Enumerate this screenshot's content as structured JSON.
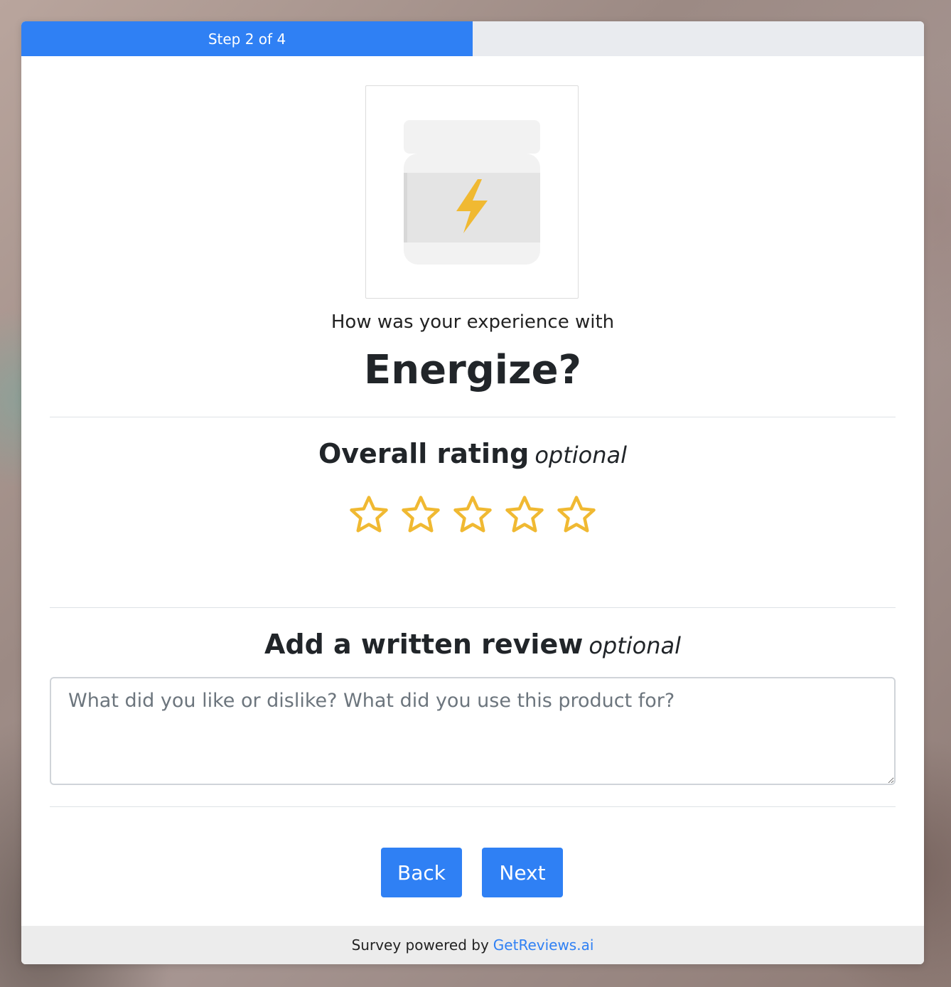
{
  "progress": {
    "label": "Step 2 of 4",
    "current_step": 2,
    "total_steps": 4,
    "fraction": 0.5
  },
  "product": {
    "image_icon": "supplement-jar-lightning-icon",
    "prompt": "How was your experience with",
    "name": "Energize?"
  },
  "rating": {
    "title": "Overall rating",
    "optional_label": "optional",
    "max_stars": 5,
    "selected": 0,
    "star_color": "#f0b932"
  },
  "review": {
    "title": "Add a written review",
    "optional_label": "optional",
    "placeholder": "What did you like or dislike? What did you use this product for?",
    "value": ""
  },
  "buttons": {
    "back_label": "Back",
    "next_label": "Next"
  },
  "footer": {
    "text": "Survey powered by",
    "link_text": "GetReviews.ai"
  },
  "colors": {
    "accent": "#2f80f4",
    "progress_track": "#e9ebef",
    "footer_bg": "#ececec"
  }
}
